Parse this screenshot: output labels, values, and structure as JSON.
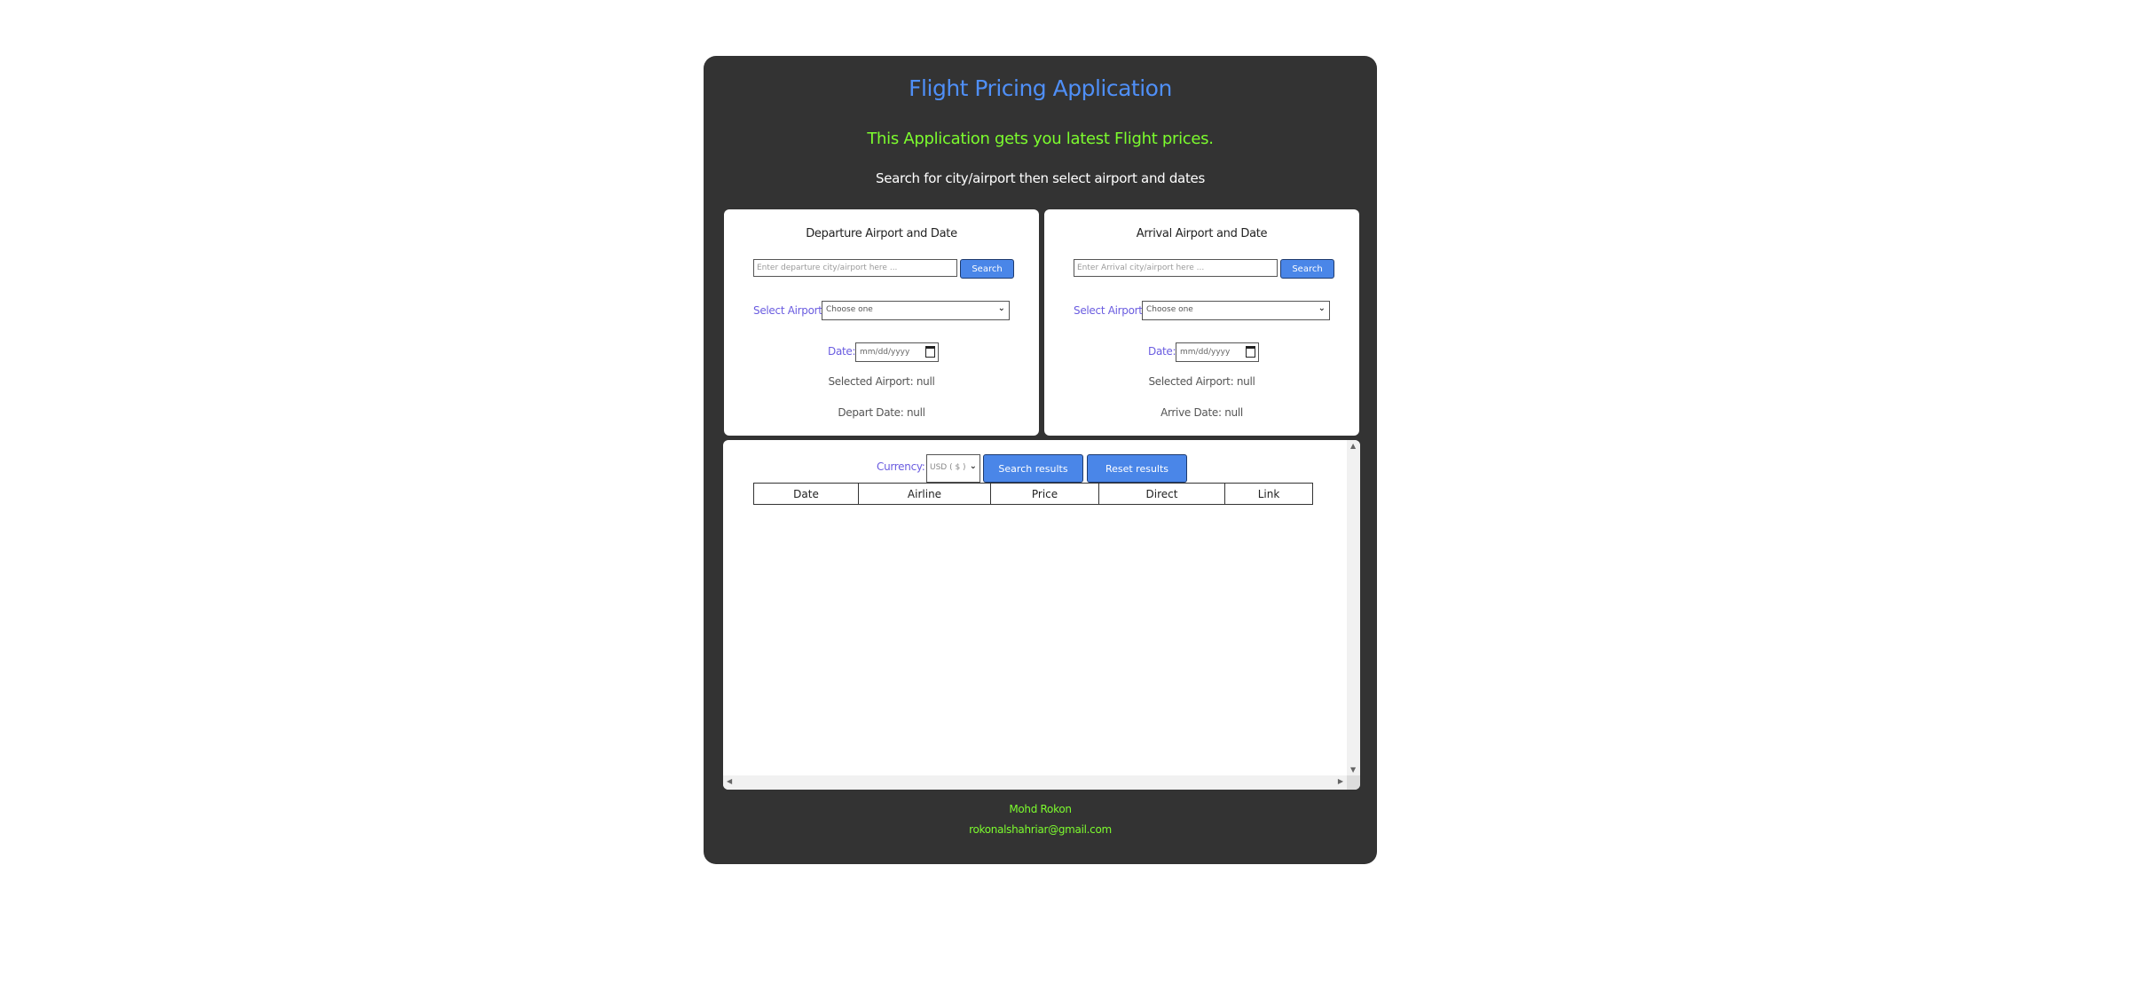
{
  "header": {
    "title": "Flight Pricing Application",
    "subtitle": "This Application gets you latest Flight prices.",
    "instruction": "Search for city/airport then select airport and dates"
  },
  "departure": {
    "title": "Departure Airport and Date",
    "search_placeholder": "Enter departure city/airport here ...",
    "search_button": "Search",
    "select_label": "Select Airport:",
    "select_value": "Choose one",
    "date_label": "Date:",
    "date_placeholder": "mm/dd/yyyy",
    "selected_airport": "Selected Airport: null",
    "date_info": "Depart Date: null"
  },
  "arrival": {
    "title": "Arrival Airport and Date",
    "search_placeholder": "Enter Arrival city/airport here ...",
    "search_button": "Search",
    "select_label": "Select Airport:",
    "select_value": "Choose one",
    "date_label": "Date:",
    "date_placeholder": "mm/dd/yyyy",
    "selected_airport": "Selected Airport: null",
    "date_info": "Arrive Date: null"
  },
  "results": {
    "currency_label": "Currency:",
    "currency_value": "USD ( $ )",
    "search_button": "Search results",
    "reset_button": "Reset results",
    "columns": [
      "Date",
      "Airline",
      "Price",
      "Direct",
      "Link"
    ]
  },
  "footer": {
    "name": "Mohd Rokon",
    "email": "rokonalshahriar@gmail.com"
  },
  "colors": {
    "title": "#4f8ff7",
    "accent_green": "#7cfc2e",
    "button": "#4a86e8",
    "label": "#6a5ce0",
    "app_bg": "#333333"
  }
}
